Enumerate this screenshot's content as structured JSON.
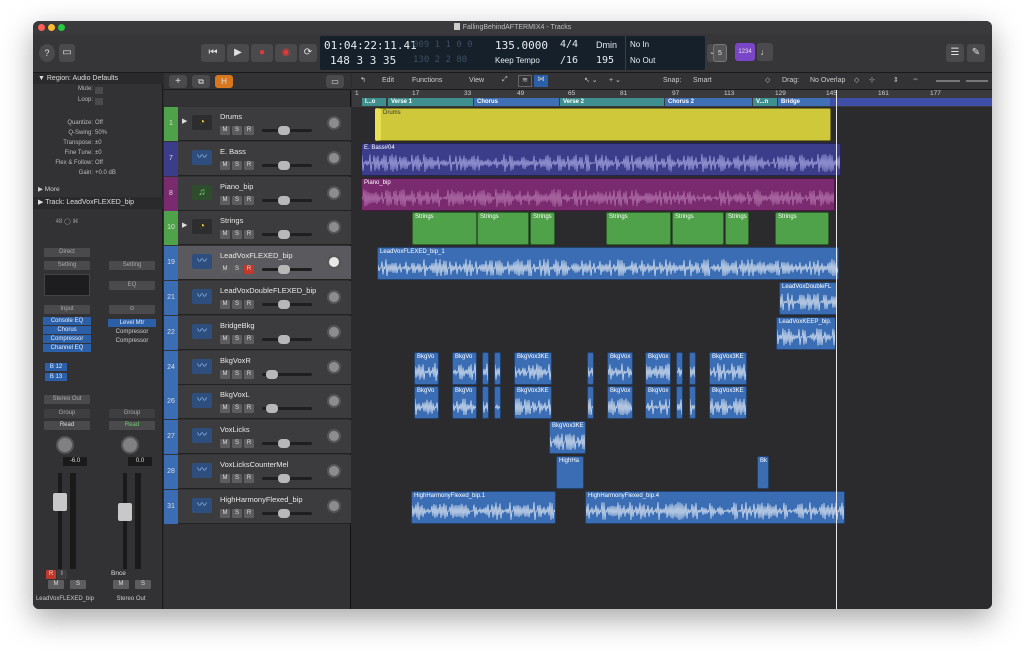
{
  "window": {
    "title": "FallingBehindAFTERMIX4 - Tracks"
  },
  "transport": {
    "position_time": "01:04:22:11.41",
    "position_time_ghost": "009 1 1 0 0",
    "position_bars": "148  3  3  35",
    "position_bars_ghost": "130 2 2 80",
    "tempo": "135.0000",
    "tempo_mode": "Keep Tempo",
    "signature": "4/4",
    "division": "/16",
    "key": "Dmin",
    "key_number": "195",
    "midi_in": "No In",
    "midi_out": "No Out",
    "lcd_mode": "1234",
    "count_badge": "5"
  },
  "inspector": {
    "region_header": "▼ Region: Audio Defaults",
    "rows": [
      {
        "k": "Mute:",
        "v": ""
      },
      {
        "k": "Loop:",
        "v": ""
      },
      {
        "k": "Quantize:",
        "v": "Off"
      },
      {
        "k": "Q-Swing:",
        "v": "50%"
      },
      {
        "k": "Transpose:",
        "v": "±0"
      },
      {
        "k": "Fine Tune:",
        "v": "±0"
      },
      {
        "k": "Flex & Follow:",
        "v": "Off"
      },
      {
        "k": "Gain:",
        "v": "+0.0 dB"
      }
    ],
    "more_label": "▶ More",
    "track_header": "▶ Track:  LeadVoxFLEXED_bip",
    "strip1": {
      "format": "48",
      "direct": "Direct",
      "setting": "Setting",
      "input": "Input",
      "plugins": [
        "Console EQ",
        "Chorus",
        "Compressor",
        "Channel EQ"
      ],
      "sends": [
        "B 12",
        "B 13"
      ],
      "output": "Stereo Out",
      "group": "Group",
      "automation": "Read",
      "value": "-6.0",
      "buttons": [
        "R",
        "I",
        "M",
        "S"
      ],
      "name": "LeadVoxFLEXED_bip"
    },
    "strip2": {
      "setting": "Setting",
      "eq": "EQ",
      "plugins": [
        "Level Mtr",
        "Compressor",
        "Compressor"
      ],
      "group": "Group",
      "automation": "Read",
      "value": "0.0",
      "bnce": "Bnce",
      "buttons": [
        "M",
        "S"
      ],
      "name": "Stereo Out"
    }
  },
  "toolbar": {
    "edit": "Edit",
    "functions": "Functions",
    "view": "View",
    "snap_label": "Snap:",
    "snap_value": "Smart",
    "drag_label": "Drag:",
    "drag_value": "No Overlap",
    "add": "+",
    "h_button": "H"
  },
  "ruler": {
    "bars": [
      "1",
      "17",
      "33",
      "49",
      "65",
      "81",
      "97",
      "113",
      "129",
      "145",
      "161",
      "177"
    ],
    "markers": [
      "I...o",
      "Verse 1",
      "Chorus",
      "Verse 2",
      "Chorus 2",
      "V...n",
      "Bridge"
    ]
  },
  "tracks": [
    {
      "num": "1",
      "name": "Drums",
      "color": "#4fa24a",
      "icon": "drummer-icon"
    },
    {
      "num": "7",
      "name": "E. Bass",
      "color": "#3b3d8a",
      "icon": "waveform-icon"
    },
    {
      "num": "8",
      "name": "Piano_bip",
      "color": "#7a2a6e",
      "icon": "midi-icon"
    },
    {
      "num": "10",
      "name": "Strings",
      "color": "#4fa24a",
      "icon": "drummer-icon"
    },
    {
      "num": "19",
      "name": "LeadVoxFLEXED_bip",
      "color": "#3a6db4",
      "icon": "waveform-icon"
    },
    {
      "num": "21",
      "name": "LeadVoxDoubleFLEXED_bip",
      "color": "#3a6db4",
      "icon": "waveform-icon"
    },
    {
      "num": "22",
      "name": "BridgeBkg",
      "color": "#3a6db4",
      "icon": "waveform-icon"
    },
    {
      "num": "24",
      "name": "BkgVoxR",
      "color": "#3a6db4",
      "icon": "waveform-icon"
    },
    {
      "num": "26",
      "name": "BkgVoxL",
      "color": "#3a6db4",
      "icon": "waveform-icon"
    },
    {
      "num": "27",
      "name": "VoxLicks",
      "color": "#3a6db4",
      "icon": "waveform-icon"
    },
    {
      "num": "28",
      "name": "VoxLicksCounterMel",
      "color": "#3a6db4",
      "icon": "waveform-icon"
    },
    {
      "num": "31",
      "name": "HighHarmonyFlexed_bip",
      "color": "#3a6db4",
      "icon": "waveform-icon"
    }
  ],
  "track_buttons": {
    "m": "M",
    "s": "S",
    "r": "R"
  },
  "regions": {
    "drums": "Drums",
    "bass": "E. Bass#04",
    "piano": "Piano_bip",
    "strings": "Strings",
    "leadvox": "LeadVoxFLEXED_bip_1",
    "leaddouble": "LeadVoxDoubleFL",
    "leadkeep": "LeadVoxKEEP_bip.",
    "bkgvo": "BkgVo",
    "bkgvox3ke": "BkgVox3KE",
    "bkgvox": "BkgVox",
    "highha": "HighHa",
    "bk": "Bk",
    "hh1": "HighHarmonyFlexed_bip.1",
    "hh4": "HighHarmonyFlexed_bip.4"
  },
  "colors": {
    "green": "#4fa24a",
    "yellow": "#cfc83a",
    "purple_bass": "#3b3d8a",
    "purple_piano": "#7a2a6e",
    "blue": "#3a6db4",
    "teal_marker": "#3f8f8f",
    "blue_marker": "#3f6fb5",
    "accent_purple": "#7b45c7"
  }
}
